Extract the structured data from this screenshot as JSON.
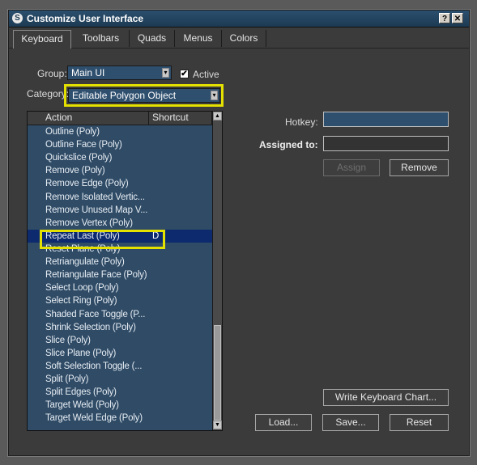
{
  "window": {
    "title": "Customize User Interface",
    "help_glyph": "?",
    "close_glyph": "✕",
    "app_icon_glyph": "S"
  },
  "tabs": [
    {
      "label": "Keyboard",
      "active": true
    },
    {
      "label": "Toolbars",
      "active": false
    },
    {
      "label": "Quads",
      "active": false
    },
    {
      "label": "Menus",
      "active": false
    },
    {
      "label": "Colors",
      "active": false
    }
  ],
  "group": {
    "label": "Group:",
    "value": "Main UI"
  },
  "active": {
    "label": "Active",
    "checked": true,
    "mark": "✔"
  },
  "category": {
    "label": "Category:",
    "value": "Editable Polygon Object"
  },
  "list": {
    "columns": [
      "Action",
      "Shortcut"
    ],
    "rows": [
      {
        "action": "Outline (Poly)",
        "shortcut": ""
      },
      {
        "action": "Outline Face (Poly)",
        "shortcut": ""
      },
      {
        "action": "Quickslice (Poly)",
        "shortcut": ""
      },
      {
        "action": "Remove (Poly)",
        "shortcut": ""
      },
      {
        "action": "Remove Edge (Poly)",
        "shortcut": ""
      },
      {
        "action": "Remove Isolated Vertic...",
        "shortcut": ""
      },
      {
        "action": "Remove Unused Map V...",
        "shortcut": ""
      },
      {
        "action": "Remove Vertex (Poly)",
        "shortcut": ""
      },
      {
        "action": "Repeat Last (Poly)",
        "shortcut": "D",
        "selected": true
      },
      {
        "action": "Reset Plane (Poly)",
        "shortcut": ""
      },
      {
        "action": "Retriangulate (Poly)",
        "shortcut": ""
      },
      {
        "action": "Retriangulate Face (Poly)",
        "shortcut": ""
      },
      {
        "action": "Select Loop (Poly)",
        "shortcut": ""
      },
      {
        "action": "Select Ring (Poly)",
        "shortcut": ""
      },
      {
        "action": "Shaded Face Toggle (P...",
        "shortcut": ""
      },
      {
        "action": "Shrink Selection (Poly)",
        "shortcut": ""
      },
      {
        "action": "Slice (Poly)",
        "shortcut": ""
      },
      {
        "action": "Slice Plane (Poly)",
        "shortcut": ""
      },
      {
        "action": "Soft Selection Toggle (...",
        "shortcut": ""
      },
      {
        "action": "Split (Poly)",
        "shortcut": ""
      },
      {
        "action": "Split Edges (Poly)",
        "shortcut": ""
      },
      {
        "action": "Target Weld (Poly)",
        "shortcut": ""
      },
      {
        "action": "Target Weld Edge (Poly)",
        "shortcut": ""
      }
    ]
  },
  "hotkey": {
    "label": "Hotkey:",
    "value": ""
  },
  "assigned_to": {
    "label": "Assigned to:",
    "value": ""
  },
  "buttons": {
    "assign": "Assign",
    "remove": "Remove",
    "write_chart": "Write Keyboard Chart...",
    "load": "Load...",
    "save": "Save...",
    "reset": "Reset"
  },
  "colors": {
    "highlight": "#e4e000",
    "selection": "#0d2a6e",
    "list_bg": "#2f4b66"
  }
}
